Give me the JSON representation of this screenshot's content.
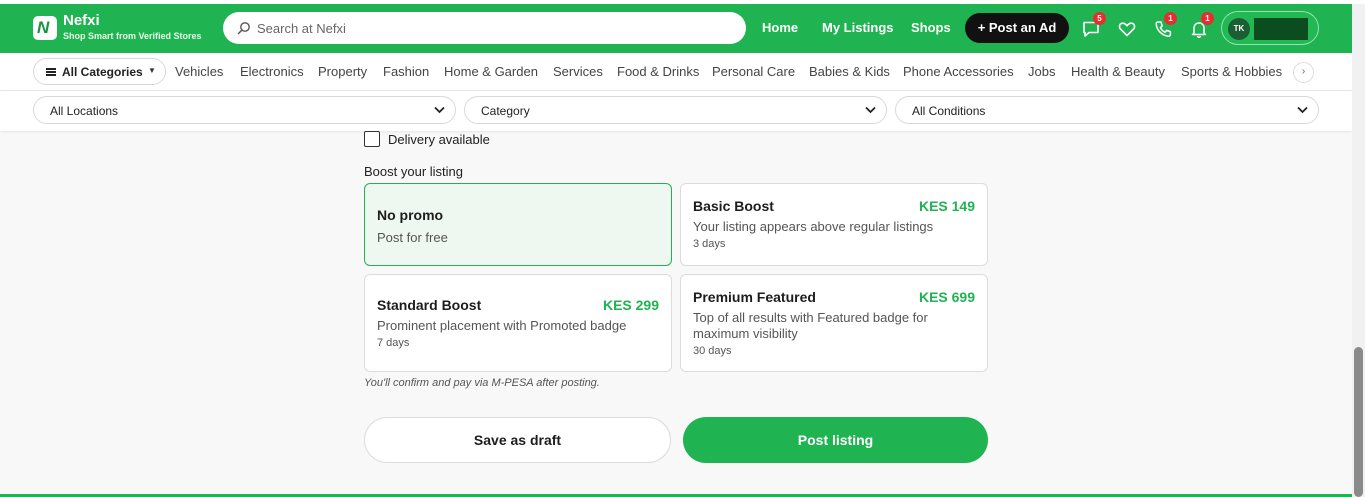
{
  "header": {
    "brand": {
      "name": "Nefxi",
      "tagline": "Shop Smart from Verified Stores",
      "logo_letter": "N"
    },
    "search": {
      "placeholder": "Search at Nefxi",
      "icon": "search-icon"
    },
    "nav": {
      "home": "Home",
      "my_listings": "My Listings",
      "shops": "Shops",
      "post_ad": "+ Post an Ad"
    },
    "icons": {
      "messages": {
        "icon": "chat-icon",
        "badge": "5"
      },
      "favorites": {
        "icon": "heart-icon"
      },
      "calls": {
        "icon": "phone-icon",
        "badge": "1"
      },
      "notifications": {
        "icon": "bell-icon",
        "badge": "1"
      }
    },
    "account": {
      "initials": "TK"
    }
  },
  "categories": {
    "all_label": "All Categories",
    "items": [
      "Vehicles",
      "Electronics",
      "Property",
      "Fashion",
      "Home & Garden",
      "Services",
      "Food & Drinks",
      "Personal Care",
      "Babies & Kids",
      "Phone Accessories",
      "Jobs",
      "Health & Beauty",
      "Sports & Hobbies"
    ],
    "next_icon": "chevron-right-icon"
  },
  "filters": {
    "location": "All Locations",
    "category": "Category",
    "condition": "All Conditions"
  },
  "form": {
    "delivery_label": "Delivery available",
    "delivery_checked": false,
    "boost_title": "Boost your listing",
    "options": [
      {
        "title": "No promo",
        "price": "",
        "desc": "Post for free",
        "days": "",
        "selected": true
      },
      {
        "title": "Basic Boost",
        "price": "KES 149",
        "desc": "Your listing appears above regular listings",
        "days": "3 days",
        "selected": false
      },
      {
        "title": "Standard Boost",
        "price": "KES 299",
        "desc": "Prominent placement with Promoted badge",
        "days": "7 days",
        "selected": false
      },
      {
        "title": "Premium Featured",
        "price": "KES 699",
        "desc": "Top of all results with Featured badge for maximum visibility",
        "days": "30 days",
        "selected": false
      }
    ],
    "payment_note": "You'll confirm and pay via M-PESA after posting.",
    "save_draft": "Save as draft",
    "post_listing": "Post listing"
  },
  "colors": {
    "brand_green": "#1fb352",
    "dark": "#111111",
    "badge_red": "#e62e2e"
  }
}
